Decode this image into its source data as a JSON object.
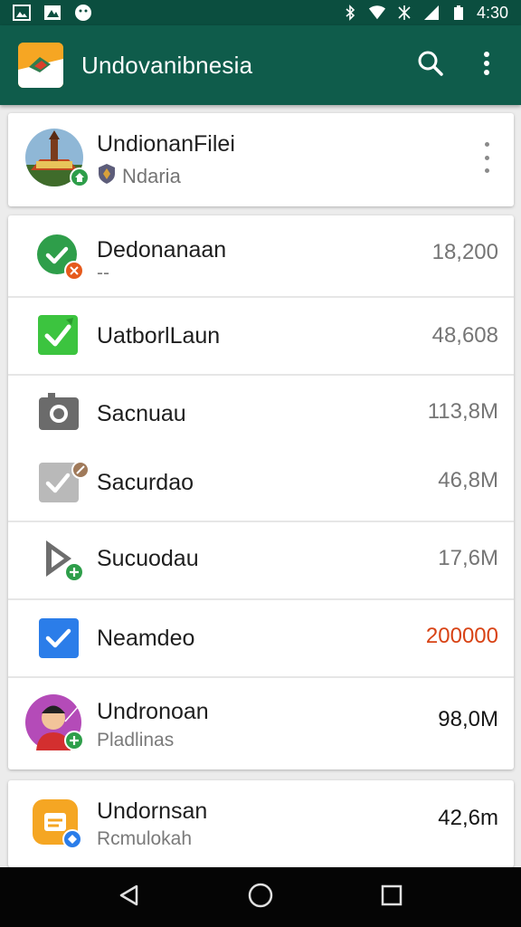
{
  "status_bar": {
    "time": "4:30"
  },
  "toolbar": {
    "title": "Undovanibnesia"
  },
  "profile": {
    "name": "UndionanFilei",
    "subtitle": "Ndaria"
  },
  "items": [
    {
      "label": "Dedonanaan",
      "sub": "--",
      "value": "18,200"
    },
    {
      "label": "UatborlLaun",
      "value": "48,608"
    },
    {
      "label": "Sacnuau",
      "value": "113,8M"
    },
    {
      "label": "Sacurdao",
      "value": "46,8M"
    },
    {
      "label": "Sucuodau",
      "value": "17,6M"
    },
    {
      "label": "Neamdeo",
      "value": "200000"
    },
    {
      "label": "Undronoan",
      "sub": "Pladlinas",
      "value": "98,0M"
    }
  ],
  "last_item": {
    "label": "Undornsan",
    "sub": "Rcmulokah",
    "value": "42,6m"
  },
  "colors": {
    "appbar": "#0f5c4b",
    "statusbar": "#0b4e3f",
    "accent_green": "#2e9e4a",
    "alert": "#d84315",
    "blue": "#2b7de9"
  },
  "icons": [
    "search-icon",
    "more-vert-icon",
    "back-icon",
    "home-icon",
    "recents-icon"
  ]
}
